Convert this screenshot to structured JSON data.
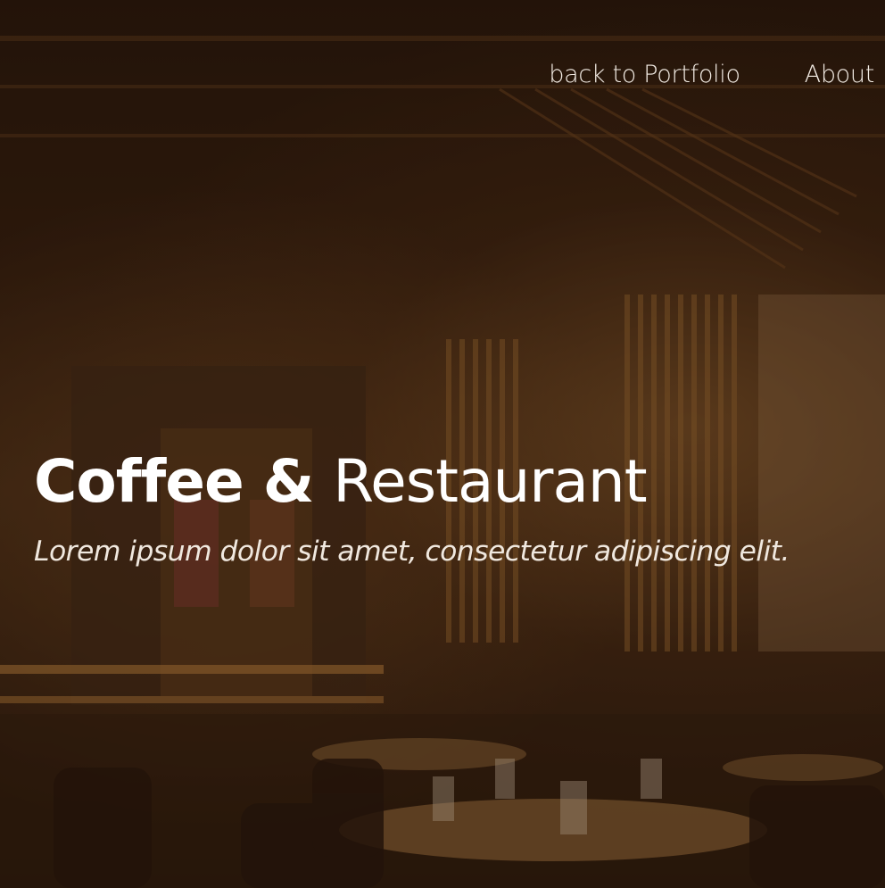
{
  "nav": {
    "items": [
      {
        "label": "back to Portfolio"
      },
      {
        "label": "About"
      }
    ]
  },
  "hero": {
    "title_bold": "Coffee &",
    "title_light": "Restaurant",
    "subtitle": "Lorem ipsum dolor sit amet, consectetur adipiscing elit."
  },
  "colors": {
    "overlay": "#2d1608",
    "text": "#ffffff",
    "wood": "#8a5a2a"
  }
}
